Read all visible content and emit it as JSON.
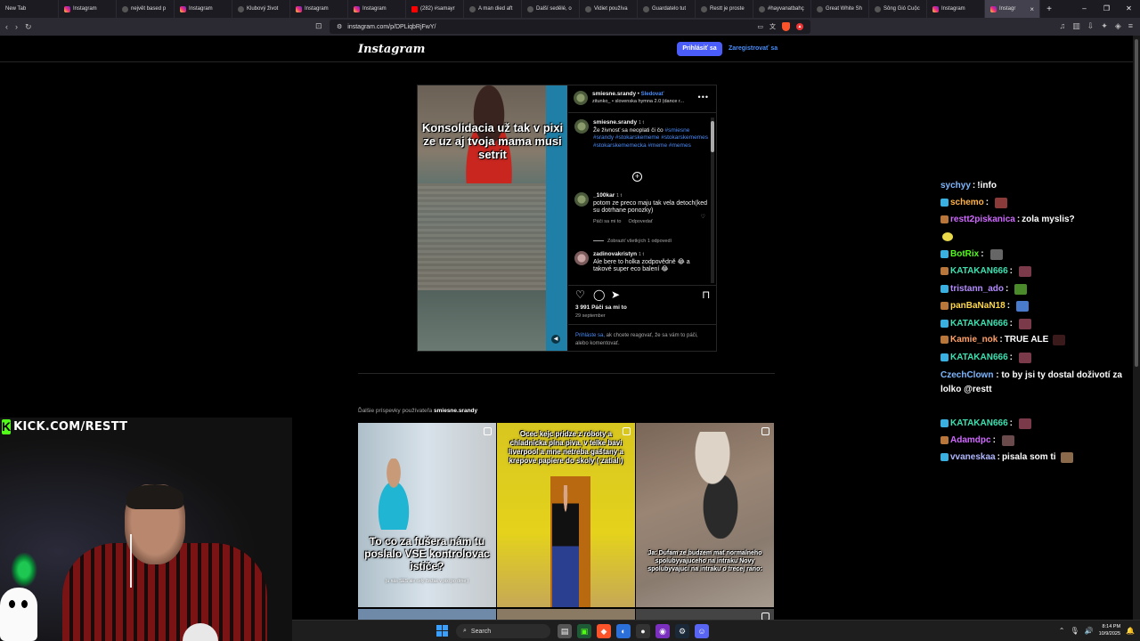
{
  "browser": {
    "tabs": [
      {
        "label": "New Tab",
        "icon": "generic"
      },
      {
        "label": "Instagram",
        "icon": "instagram"
      },
      {
        "label": "největ based p",
        "icon": "generic"
      },
      {
        "label": "Instagram",
        "icon": "instagram"
      },
      {
        "label": "Klubový život",
        "icon": "generic"
      },
      {
        "label": "Instagram",
        "icon": "instagram"
      },
      {
        "label": "Instagram",
        "icon": "instagram"
      },
      {
        "label": "(282) #samayr",
        "icon": "youtube"
      },
      {
        "label": "A man died aft",
        "icon": "generic"
      },
      {
        "label": "Další sedělé, o",
        "icon": "generic"
      },
      {
        "label": "Vidiet používa",
        "icon": "generic"
      },
      {
        "label": "Guardatelo tut",
        "icon": "generic"
      },
      {
        "label": "Restt je proste",
        "icon": "generic"
      },
      {
        "label": "#hayvanatbahç",
        "icon": "generic"
      },
      {
        "label": "Great White Sh",
        "icon": "generic"
      },
      {
        "label": "Sông Gió Cuộc",
        "icon": "generic"
      },
      {
        "label": "Instagram",
        "icon": "instagram"
      },
      {
        "label": "Instagr",
        "icon": "instagram",
        "active": true
      }
    ],
    "url": "instagram.com/p/DPLiqbRjFwY/",
    "window_controls": [
      "–",
      "❐",
      "✕"
    ]
  },
  "ig": {
    "logo": "Instagram",
    "login_button": "Prihlásiť sa",
    "register_link": "Zaregistrovať sa",
    "post": {
      "caption_overlay": "Konsolidacia už tak v pixi ze uz aj tvoja mama musi setrit",
      "username": "smiesne.srandy",
      "follow": "Sledovať",
      "song": "zitunko_ • slovenska hymna 2.0 (dance r...",
      "author_comment": {
        "user": "smiesne.srandy",
        "time": "1 t",
        "text": "Že živnosť sa neoplati či čo",
        "tags": "#smiesne #srandy #stokarskememe #stokarskememes #stokarskememecka #meme #memes"
      },
      "comments": [
        {
          "user": "_100kar",
          "time": "1 t",
          "text": "potom ze preco maju tak vela detoch(ked su dotrhane ponozky)",
          "likes": "Páči sa mi to",
          "reply": "Odpovedať"
        },
        {
          "user": "zadinovakristyn",
          "time": "1 t",
          "text": "Ale bere to holka zodpovědně 😂 a takové super eco balení 😂"
        }
      ],
      "view_replies": "Zobraziť všetkých 1 odpovedí",
      "likes_count": "3 991 Páči sa mi to",
      "date": "29 september",
      "login_link": "Prihláste sa,",
      "login_note": " ak chcete reagovať, že sa vám to páči, alebo komentovať."
    },
    "more_posts_label": "Ďalšie príspevky používateľa",
    "more_posts_user": "smiesne.srandy",
    "grid": [
      {
        "caption": "To co za fušera nám tu poslalo VSE kontrolovac ističe?",
        "sub": "(u nás SES ale celý činžak v pixi po drne )"
      },
      {
        "caption": "Ocec kejc pridze z roboty a chladnicka plna piva, v telke bavi liverpool a mne netreba gaštany a krepove papiere do skoly ( zatial )"
      },
      {
        "caption": "Ja: Dufam ze budzem mat normalneho spolubyvajuceho na intraku Novy spolubyvajuci na intraku o trecej rano:"
      }
    ]
  },
  "chat": [
    {
      "user": "sychyy",
      "color": "#7eb8ff",
      "msg": "!info"
    },
    {
      "user": "schemo",
      "color": "#ffb347",
      "msg": "",
      "emote": "#8b3a3a"
    },
    {
      "user": "restt2piskanica",
      "color": "#d06aff",
      "msg": "zola myslis?"
    },
    {
      "user": "BotRix",
      "color": "#53fc18",
      "msg": "",
      "emote": "#666"
    },
    {
      "user": "KATAKAN666",
      "color": "#3de0b0",
      "msg": "",
      "emote": "#7a3a4a"
    },
    {
      "user": "tristann_ado",
      "color": "#b48cff",
      "msg": "",
      "emote": "#4a8a2a"
    },
    {
      "user": "panBaNaN18",
      "color": "#ffd84a",
      "msg": "",
      "emote": "#4a7acc"
    },
    {
      "user": "KATAKAN666",
      "color": "#3de0b0",
      "msg": "",
      "emote": "#7a3a4a"
    },
    {
      "user": "Kamie_nok",
      "color": "#ffa066",
      "msg": "TRUE ALE",
      "emote": "#3a1a1a"
    },
    {
      "user": "KATAKAN666",
      "color": "#3de0b0",
      "msg": "",
      "emote": "#7a3a4a"
    },
    {
      "user": "CzechClown",
      "color": "#7eb8ff",
      "msg": "to by jsi ty dostal doživotí za lolko @restt"
    },
    {
      "user": "KATAKAN666",
      "color": "#3de0b0",
      "msg": "",
      "emote": "#7a3a4a"
    },
    {
      "user": "Adamdpc",
      "color": "#d06aff",
      "msg": "",
      "emote": "#6a4a4a"
    },
    {
      "user": "vvaneskaa",
      "color": "#b0b8ff",
      "msg": "pisala som ti",
      "emote": "#8a6a4a"
    }
  ],
  "stream": {
    "kick_banner": "KICK.COM/RESTT",
    "kick_logo": "K"
  },
  "taskbar": {
    "search": "Search",
    "time": "8:14 PM",
    "date": "10/9/2025"
  }
}
